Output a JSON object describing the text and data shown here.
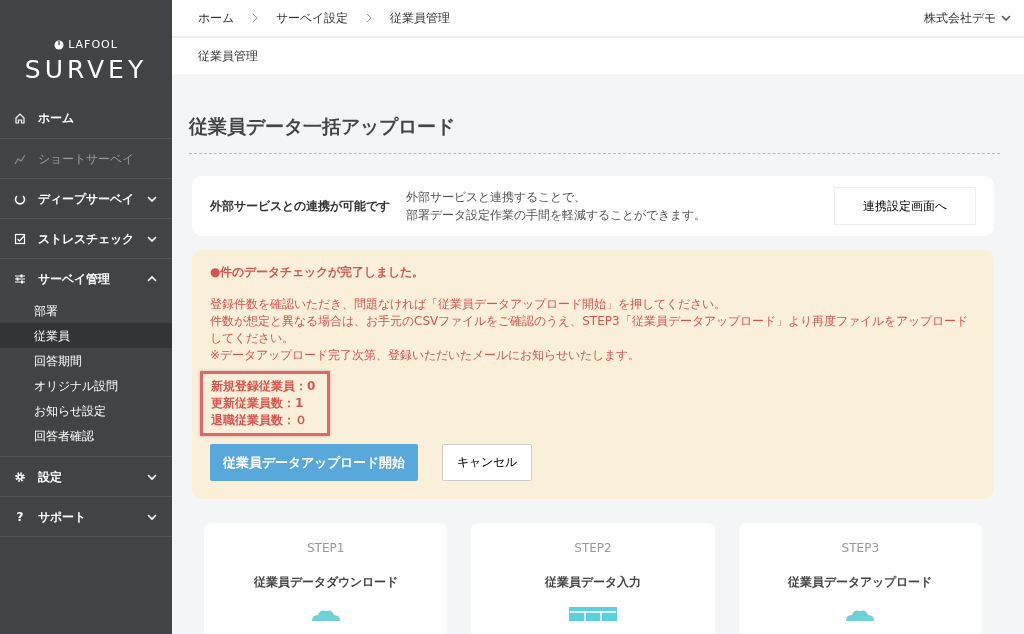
{
  "sidebar": {
    "logo": {
      "brand": "LAFOOL",
      "title": "SURVEY"
    },
    "items": [
      {
        "label": "ホーム",
        "disabled": false
      },
      {
        "label": "ショートサーベイ",
        "disabled": true
      },
      {
        "label": "ディープサーベイ",
        "disabled": false,
        "expanded": false
      },
      {
        "label": "ストレスチェック",
        "disabled": false,
        "expanded": false
      },
      {
        "label": "サーベイ管理",
        "disabled": false,
        "expanded": true,
        "children": [
          {
            "label": "部署",
            "selected": false
          },
          {
            "label": "従業員",
            "selected": true
          },
          {
            "label": "回答期間",
            "selected": false
          },
          {
            "label": "オリジナル設問",
            "selected": false
          },
          {
            "label": "お知らせ設定",
            "selected": false
          },
          {
            "label": "回答者確認",
            "selected": false
          }
        ]
      },
      {
        "label": "設定",
        "disabled": false,
        "expanded": false
      },
      {
        "label": "サポート",
        "glyph": "?",
        "disabled": false,
        "expanded": false
      }
    ]
  },
  "breadcrumb": [
    "ホーム",
    "サーベイ設定",
    "従業員管理"
  ],
  "account": "株式会社デモ",
  "page_tab": "従業員管理",
  "title": "従業員データ一括アップロード",
  "integration": {
    "heading": "外部サービスとの連携が可能です",
    "lines": [
      "外部サービスと連携することで、",
      "部署データ設定作業の手間を軽減することができます。"
    ],
    "button": "連携設定画面へ"
  },
  "alert": {
    "heading": "●件のデータチェックが完了しました。",
    "lines": [
      "登録件数を確認いただき、問題なければ「従業員データアップロード開始」を押してください。",
      "件数が想定と異なる場合は、お手元のCSVファイルをご確認のうえ、STEP3「従業員データアップロード」より再度ファイルをアップロードしてください。",
      "※データアップロード完了次第、登録いただいたメールにお知らせいたします。"
    ],
    "counts": [
      "新規登録従業員：0",
      "更新従業員数：1",
      "退職従業員数：０"
    ],
    "primary_button": "従業員データアップロード開始",
    "cancel_button": "キャンセル"
  },
  "steps": [
    {
      "step": "STEP1",
      "label": "従業員データダウンロード"
    },
    {
      "step": "STEP2",
      "label": "従業員データ入力"
    },
    {
      "step": "STEP3",
      "label": "従業員データアップロード"
    }
  ]
}
